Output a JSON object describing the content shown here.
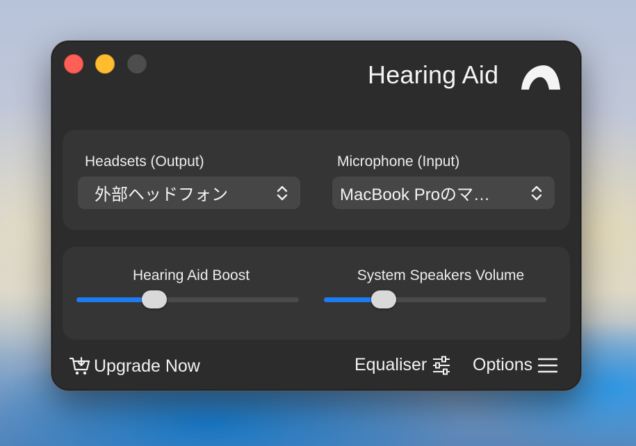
{
  "window": {
    "title": "Hearing Aid",
    "logo_icon": "half-dome-icon"
  },
  "devices": {
    "output": {
      "label": "Headsets (Output)",
      "value": "外部ヘッドフォン",
      "icon": "chevron-up-down-icon"
    },
    "input": {
      "label": "Microphone (Input)",
      "value": "MacBook Proのマ…",
      "icon": "chevron-up-down-icon"
    }
  },
  "sliders": {
    "boost": {
      "label": "Hearing Aid Boost",
      "level": 0.35
    },
    "speakers": {
      "label": "System Speakers Volume",
      "level": 0.27
    }
  },
  "footer": {
    "upgrade": {
      "label": "Upgrade Now",
      "icon": "cart-icon"
    },
    "equaliser": {
      "label": "Equaliser",
      "icon": "sliders-icon"
    },
    "options": {
      "label": "Options",
      "icon": "menu-icon"
    }
  },
  "colors": {
    "accent": "#1e7cf0",
    "window_bg": "#2c2c2c",
    "panel_bg": "#353535",
    "close": "#fe5f57",
    "minimize": "#febc2e",
    "zoom_disabled": "#4d4d4d"
  }
}
